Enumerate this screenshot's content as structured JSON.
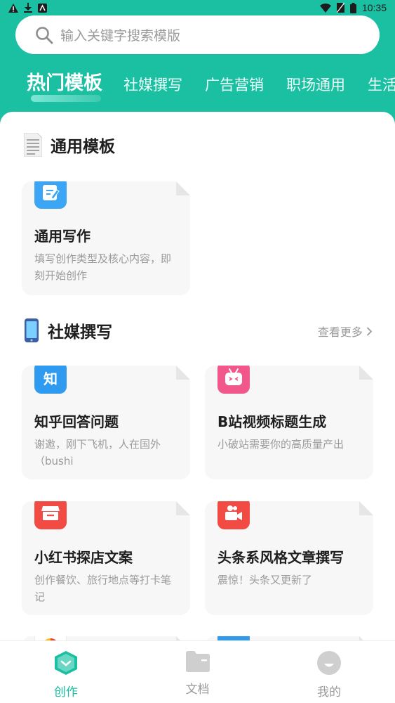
{
  "status_bar": {
    "time": "10:35"
  },
  "search": {
    "placeholder": "输入关键字搜索模版"
  },
  "tabs": [
    {
      "label": "热门模板"
    },
    {
      "label": "社媒撰写"
    },
    {
      "label": "广告营销"
    },
    {
      "label": "职场通用"
    },
    {
      "label": "生活"
    }
  ],
  "sections": [
    {
      "title": "通用模板",
      "icon": "document-icon",
      "cards": [
        {
          "title": "通用写作",
          "desc": "填写创作类型及核心内容，即刻开始创作",
          "icon": "edit-icon",
          "color": "#3aa6f5"
        }
      ]
    },
    {
      "title": "社媒撰写",
      "more": "查看更多",
      "icon": "phone-icon",
      "cards": [
        {
          "title": "知乎回答问题",
          "desc": "谢邀，刚下飞机，人在国外（bushi",
          "icon_text": "知",
          "color": "#2f9bf0"
        },
        {
          "title": "B站视频标题生成",
          "desc": "小破站需要你的高质量产出",
          "icon": "bilibili-icon",
          "color": "#f2578c"
        },
        {
          "title": "小红书探店文案",
          "desc": "创作餐饮、旅行地点等打卡笔记",
          "icon": "shop-icon",
          "color": "#f14b44"
        },
        {
          "title": "头条系风格文章撰写",
          "desc": "震惊！头条又更新了",
          "icon": "video-icon",
          "color": "#f14b44"
        }
      ]
    }
  ],
  "bottom_nav": [
    {
      "label": "创作",
      "active": true
    },
    {
      "label": "文档",
      "active": false
    },
    {
      "label": "我的",
      "active": false
    }
  ],
  "colors": {
    "accent": "#1bbfa2"
  }
}
